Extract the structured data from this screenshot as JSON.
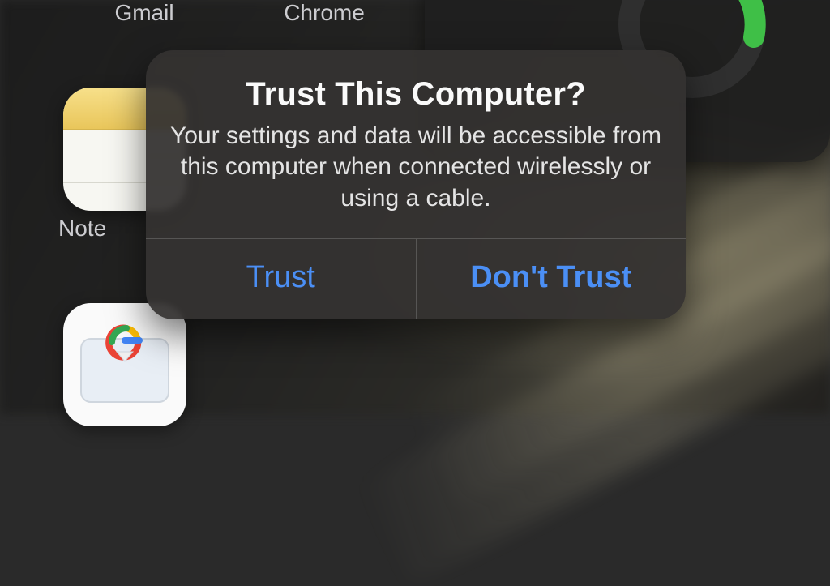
{
  "apps": {
    "gmail_label": "Gmail",
    "chrome_label": "Chrome",
    "notes_label": "Note"
  },
  "dialog": {
    "title": "Trust This Computer?",
    "message": "Your settings and data will be accessible from this computer when connected wirelessly or using a cable.",
    "trust_label": "Trust",
    "dont_trust_label": "Don't Trust"
  },
  "colors": {
    "button": "#4b8ff5",
    "dialog_bg": "rgba(52,50,49,0.94)"
  },
  "icons": {
    "notes": "notes-icon",
    "gboard": "gboard-icon",
    "activity_ring": "activity-ring-icon"
  }
}
